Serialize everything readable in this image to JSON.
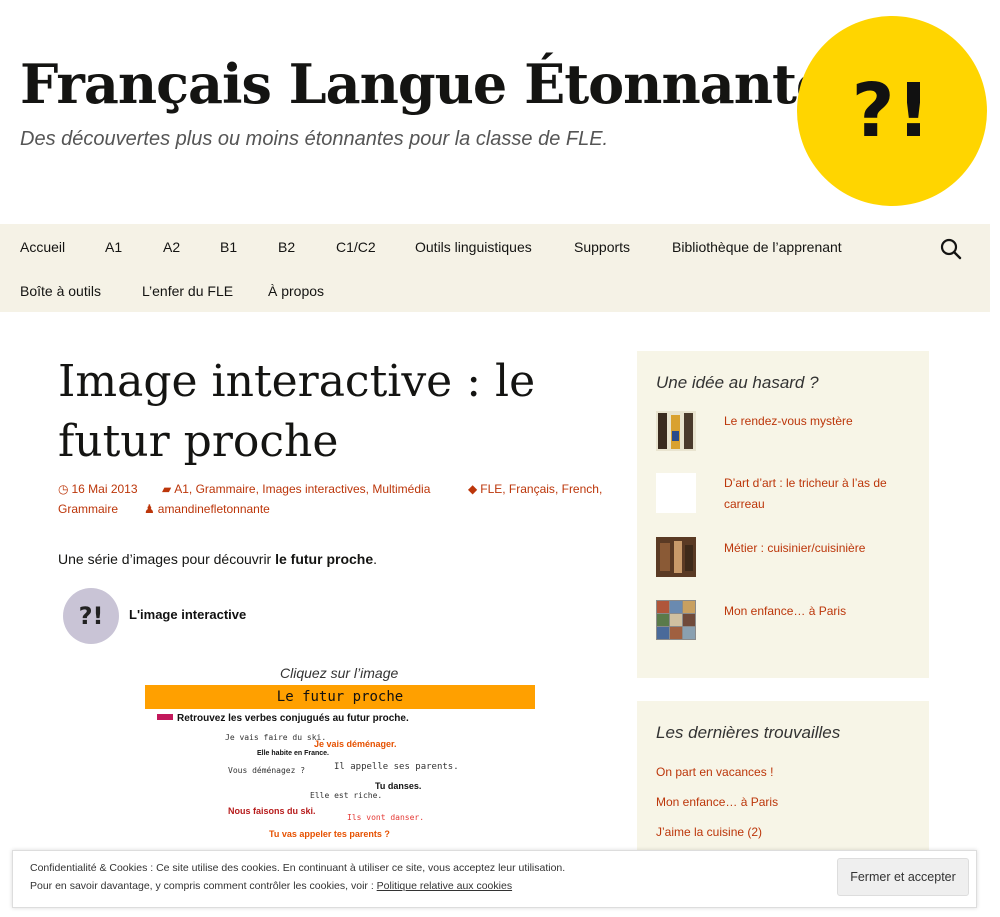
{
  "header": {
    "site_title": "Français Langue Étonnante",
    "site_description": "Des découvertes plus ou moins étonnantes pour la classe de FLE.",
    "logo_text": "?!",
    "logo_color": "#ffd500"
  },
  "nav": {
    "row1": [
      "Accueil",
      "A1",
      "A2",
      "B1",
      "B2",
      "C1/C2",
      "Outils linguistiques",
      "Supports",
      "Bibliothèque de l’apprenant"
    ],
    "row2": [
      "Boîte à outils",
      "L’enfer du FLE",
      "À propos"
    ],
    "search_icon": "search-icon"
  },
  "post": {
    "title_line1": "Image interactive : le",
    "title_line2": "futur proche",
    "date": "16 Mai 2013",
    "categories": [
      "A1",
      "Grammaire",
      "Images interactives",
      "Multimédia"
    ],
    "tags": [
      "FLE",
      "Français",
      "French",
      "Grammaire"
    ],
    "author": "amandinefletonnante",
    "intro_text": "Une série d’images pour découvrir ",
    "intro_bold": "le futur proche",
    "intro_end": ".",
    "embed_label": "L'image interactive",
    "click_caption": "Cliquez sur l’image",
    "banner_title": "Le futur proche",
    "banner_color": "#ffa000",
    "instruction": "Retrouvez les verbes conjugués au futur proche.",
    "phrases": [
      "Je vais faire du ski.",
      "Je vais déménager.",
      "Elle habite en France.",
      "Il appelle ses parents.",
      "Vous déménagez ?",
      "Tu danses.",
      "Elle est riche.",
      "Nous faisons du ski.",
      "Ils vont danser.",
      "Tu vas appeler tes parents ?"
    ]
  },
  "sidebar": {
    "random": {
      "title": "Une idée au hasard ?",
      "items": [
        "Le rendez-vous mystère",
        "D’art d’art : le tricheur à l’as de carreau",
        "Métier : cuisinier/cuisinière",
        "Mon enfance… à Paris"
      ]
    },
    "latest": {
      "title": "Les dernières trouvailles",
      "items": [
        "On part en vacances !",
        "Mon enfance… à Paris",
        "J’aime la cuisine (2)"
      ]
    }
  },
  "cookie": {
    "line1": "Confidentialité & Cookies : Ce site utilise des cookies. En continuant à utiliser ce site, vous acceptez leur utilisation.",
    "line2": "Pour en savoir davantage, y compris comment contrôler les cookies, voir : ",
    "link": "Politique relative aux cookies",
    "button": "Fermer et accepter"
  },
  "colors": {
    "nav_bg": "#f5f2e6",
    "link": "#bc360a",
    "widget_bg": "#f7f5e7"
  }
}
